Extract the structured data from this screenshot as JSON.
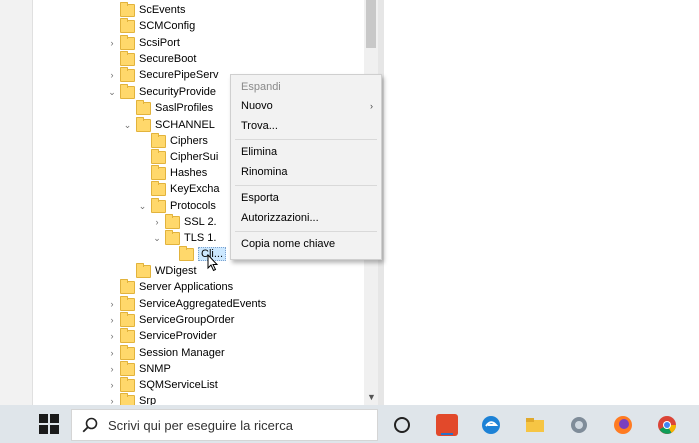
{
  "tree": {
    "nodes": [
      {
        "label": "ScEvents",
        "expander": ""
      },
      {
        "label": "SCMConfig",
        "expander": ""
      },
      {
        "label": "ScsiPort",
        "expander": "›"
      },
      {
        "label": "SecureBoot",
        "expander": ""
      },
      {
        "label": "SecurePipeServ",
        "expander": "›"
      },
      {
        "label": "SecurityProvide",
        "expander": "⌄"
      },
      {
        "label": "SaslProfiles",
        "expander": ""
      },
      {
        "label": "SCHANNEL",
        "expander": "⌄"
      },
      {
        "label": "Ciphers",
        "expander": ""
      },
      {
        "label": "CipherSui",
        "expander": ""
      },
      {
        "label": "Hashes",
        "expander": ""
      },
      {
        "label": "KeyExcha",
        "expander": ""
      },
      {
        "label": "Protocols",
        "expander": "⌄"
      },
      {
        "label": "SSL 2.",
        "expander": "›"
      },
      {
        "label": "TLS 1.",
        "expander": "⌄"
      },
      {
        "label": "Cli...",
        "expander": ""
      },
      {
        "label": "WDigest",
        "expander": ""
      },
      {
        "label": "Server Applications",
        "expander": ""
      },
      {
        "label": "ServiceAggregatedEvents",
        "expander": "›"
      },
      {
        "label": "ServiceGroupOrder",
        "expander": "›"
      },
      {
        "label": "ServiceProvider",
        "expander": "›"
      },
      {
        "label": "Session Manager",
        "expander": "›"
      },
      {
        "label": "SNMP",
        "expander": "›"
      },
      {
        "label": "SQMServiceList",
        "expander": "›"
      },
      {
        "label": "Srp",
        "expander": "›"
      }
    ]
  },
  "context_menu": {
    "items": [
      {
        "label": "Espandi",
        "disabled": true
      },
      {
        "label": "Nuovo",
        "submenu": "›"
      },
      {
        "label": "Trova..."
      },
      {
        "label": "Elimina"
      },
      {
        "label": "Rinomina"
      },
      {
        "label": "Esporta"
      },
      {
        "label": "Autorizzazioni..."
      },
      {
        "label": "Copia nome chiave"
      }
    ]
  },
  "taskbar": {
    "search_placeholder": "Scrivi qui per eseguire la ricerca",
    "icons": [
      "cortana-icon",
      "media-app-icon",
      "edge-icon",
      "file-explorer-icon",
      "network-app-icon",
      "firefox-icon",
      "chrome-icon"
    ]
  },
  "colors": {
    "folder": "#ffd86b",
    "selection": "#cce8ff",
    "taskbar": "#dfe5ea",
    "menu_bg": "#f2f2f2"
  }
}
